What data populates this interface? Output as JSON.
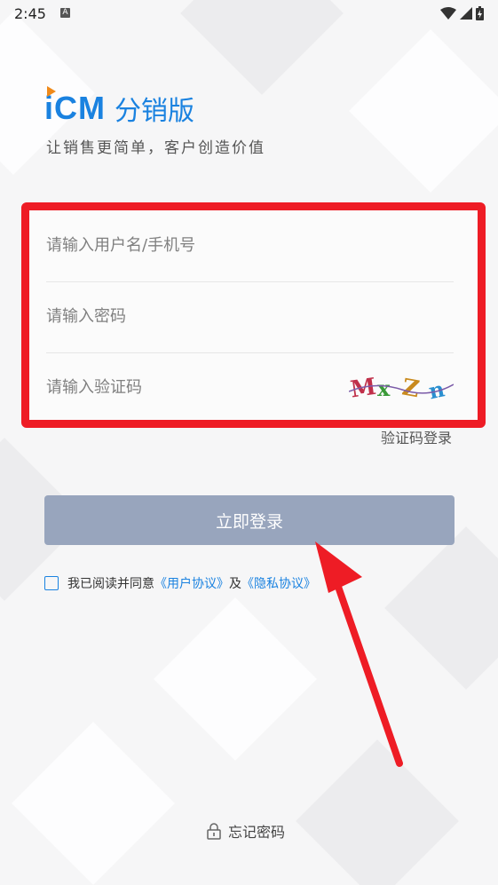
{
  "status_bar": {
    "time": "2:45",
    "notification_letter": "A"
  },
  "brand": {
    "logo_text": "iCM",
    "edition": "分销版",
    "slogan": "让销售更简单，客户创造价值"
  },
  "form": {
    "username_placeholder": "请输入用户名/手机号",
    "password_placeholder": "请输入密码",
    "captcha_placeholder": "请输入验证码",
    "captcha_image_text": "MXZN"
  },
  "links": {
    "sms_login": "验证码登录",
    "forgot_password": "忘记密码"
  },
  "buttons": {
    "login": "立即登录"
  },
  "agreement": {
    "prefix": "我已阅读并同意",
    "user_agreement": "《用户协议》",
    "and": "及",
    "privacy_policy": "《隐私协议》"
  },
  "colors": {
    "brand": "#1a82e0",
    "highlight_box": "#ee1c25",
    "button_disabled": "#98a5bd"
  }
}
